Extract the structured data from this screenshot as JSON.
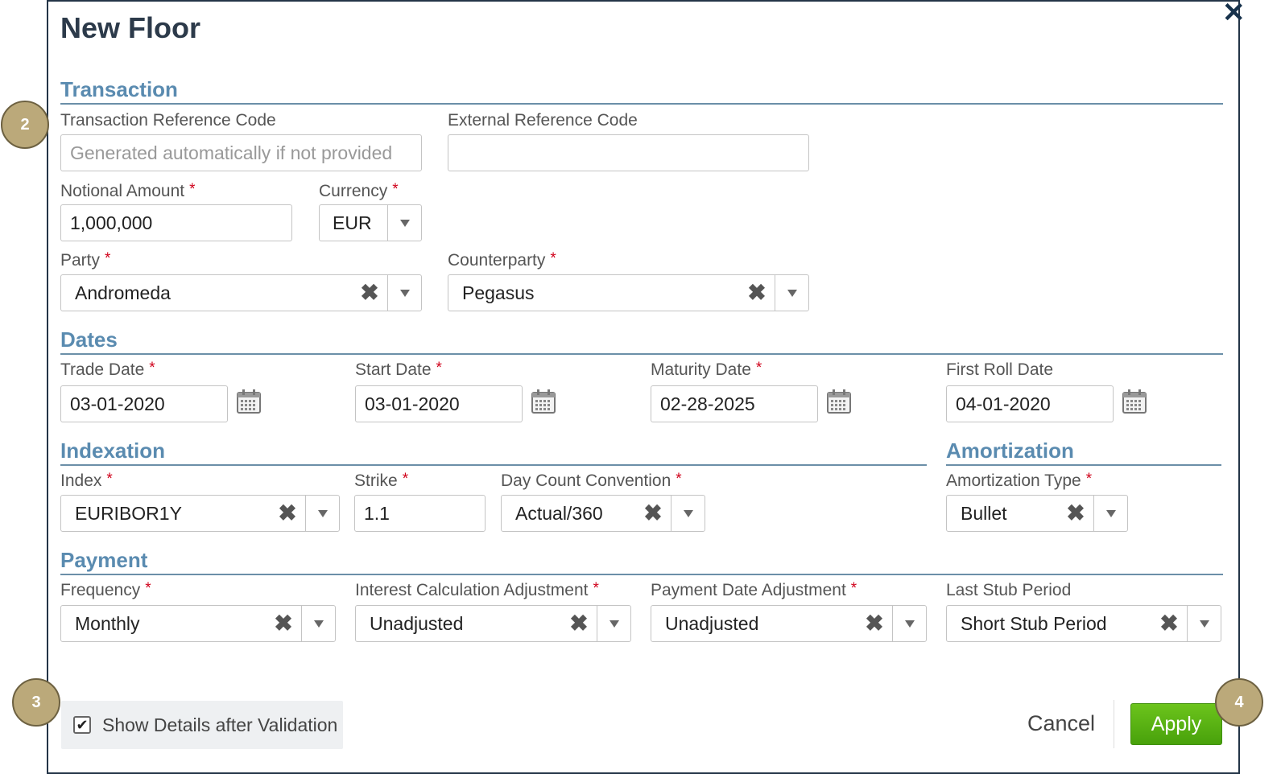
{
  "dialog": {
    "title": "New Floor",
    "close_glyph": "✕"
  },
  "sections": {
    "transaction": "Transaction",
    "dates": "Dates",
    "indexation": "Indexation",
    "amortization": "Amortization",
    "payment": "Payment"
  },
  "fields": {
    "transaction_ref": {
      "label": "Transaction Reference Code",
      "value": "",
      "placeholder": "Generated automatically if not provided"
    },
    "external_ref": {
      "label": "External Reference Code",
      "value": "",
      "placeholder": ""
    },
    "notional": {
      "label": "Notional Amount",
      "value": "1,000,000",
      "required": "*"
    },
    "currency": {
      "label": "Currency",
      "value": "EUR",
      "required": "*"
    },
    "party": {
      "label": "Party",
      "value": "Andromeda",
      "required": "*"
    },
    "counterparty": {
      "label": "Counterparty",
      "value": "Pegasus",
      "required": "*"
    },
    "trade_date": {
      "label": "Trade Date",
      "value": "03-01-2020",
      "required": "*"
    },
    "start_date": {
      "label": "Start Date",
      "value": "03-01-2020",
      "required": "*"
    },
    "maturity_date": {
      "label": "Maturity Date",
      "value": "02-28-2025",
      "required": "*"
    },
    "first_roll_date": {
      "label": "First Roll Date",
      "value": "04-01-2020"
    },
    "index": {
      "label": "Index",
      "value": "EURIBOR1Y",
      "required": "*"
    },
    "strike": {
      "label": "Strike",
      "value": "1.1",
      "required": "*"
    },
    "day_count": {
      "label": "Day Count Convention",
      "value": "Actual/360",
      "required": "*"
    },
    "amortization_type": {
      "label": "Amortization Type",
      "value": "Bullet",
      "required": "*"
    },
    "frequency": {
      "label": "Frequency",
      "value": "Monthly",
      "required": "*"
    },
    "interest_adj": {
      "label": "Interest Calculation Adjustment",
      "value": "Unadjusted",
      "required": "*"
    },
    "payment_adj": {
      "label": "Payment Date Adjustment",
      "value": "Unadjusted",
      "required": "*"
    },
    "last_stub": {
      "label": "Last Stub Period",
      "value": "Short Stub Period"
    }
  },
  "icons": {
    "clear": "✖",
    "calendar": "calendar-icon",
    "dropdown": "chevron-down-icon"
  },
  "footer": {
    "show_details_label": "Show Details after Validation",
    "show_details_checked": true,
    "check_glyph": "✔",
    "cancel_label": "Cancel",
    "apply_label": "Apply"
  },
  "callouts": {
    "c2": "2",
    "c3": "3",
    "c4": "4"
  },
  "colors": {
    "accent": "#5a8bb0",
    "apply": "#5bb313",
    "required": "#d0021b",
    "callout": "#bba97a"
  }
}
